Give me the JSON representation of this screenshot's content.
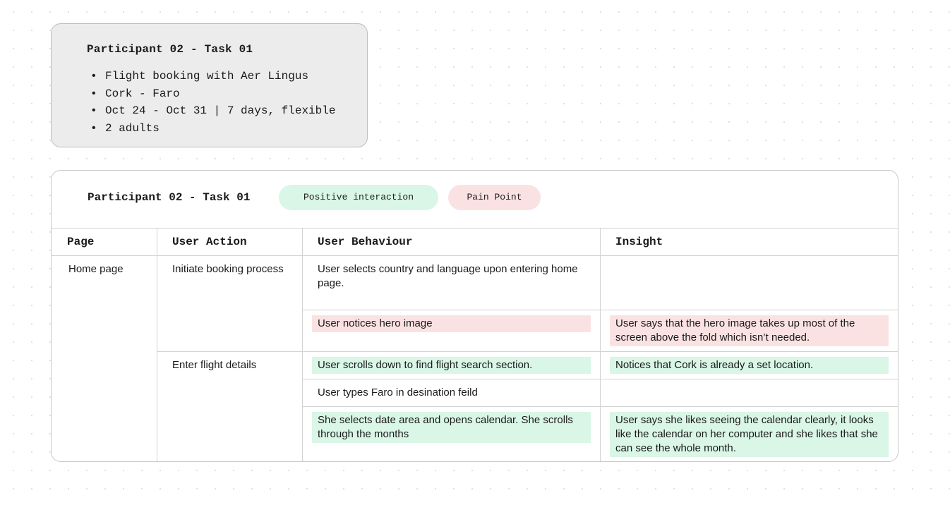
{
  "summary": {
    "title": "Participant 02 - Task 01",
    "items": [
      "Flight booking with Aer Lingus",
      "Cork - Faro",
      "Oct 24 - Oct 31 | 7 days, flexible",
      "2 adults"
    ]
  },
  "board": {
    "title": "Participant 02 - Task 01",
    "legend": {
      "positive": "Positive interaction",
      "pain": "Pain Point"
    },
    "columns": {
      "page": "Page",
      "action": "User Action",
      "behaviour": "User Behaviour",
      "insight": "Insight"
    },
    "rows": {
      "page_home": "Home page",
      "action_initiate": "Initiate booking process",
      "action_enter": "Enter flight details",
      "b1": "User selects country and language upon entering home page.",
      "b2": "User notices hero image",
      "i2": "User says that the hero image takes up most of the screen above the fold which isn’t needed.",
      "b3": "User scrolls down to find flight search section.",
      "i3": "Notices that Cork is already a set location.",
      "b4": "User types Faro in desination feild",
      "b5": "She selects date area and opens calendar. She scrolls through the months",
      "i5": "User says she likes seeing the calendar clearly, it looks like the calendar on her computer and she likes that she can see the whole month."
    },
    "colors": {
      "positive": "#d9f6e7",
      "pain": "#fbe2e2",
      "summary_bg": "#ececec"
    }
  }
}
